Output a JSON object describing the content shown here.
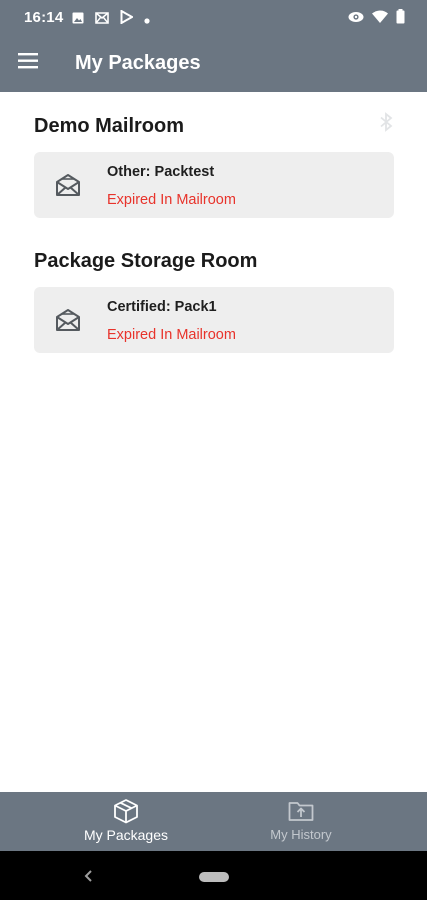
{
  "status_bar": {
    "time": "16:14",
    "icons_left": [
      "image-icon",
      "mail-icon",
      "play-store-icon",
      "notification-dot-icon"
    ],
    "icons_right": [
      "eye-icon",
      "wifi-icon",
      "battery-icon"
    ]
  },
  "app_bar": {
    "menu_icon": "menu-icon",
    "title": "My Packages"
  },
  "sections": [
    {
      "title": "Demo Mailroom",
      "packages": [
        {
          "title": "Other: Packtest",
          "status": "Expired In Mailroom",
          "icon": "envelope-open-icon"
        }
      ]
    },
    {
      "title": "Package Storage Room",
      "packages": [
        {
          "title": "Certified: Pack1",
          "status": "Expired In Mailroom",
          "icon": "envelope-open-icon"
        }
      ]
    }
  ],
  "bottom_nav": {
    "items": [
      {
        "label": "My Packages",
        "icon": "package-box-icon",
        "active": true
      },
      {
        "label": "My History",
        "icon": "folder-upload-icon",
        "active": false
      }
    ]
  },
  "colors": {
    "app_bar": "#6b7682",
    "status_expired": "#e8332b",
    "card_background": "#eeeeee",
    "nav_active": "#ffffff",
    "nav_inactive": "#c3c8ce"
  }
}
